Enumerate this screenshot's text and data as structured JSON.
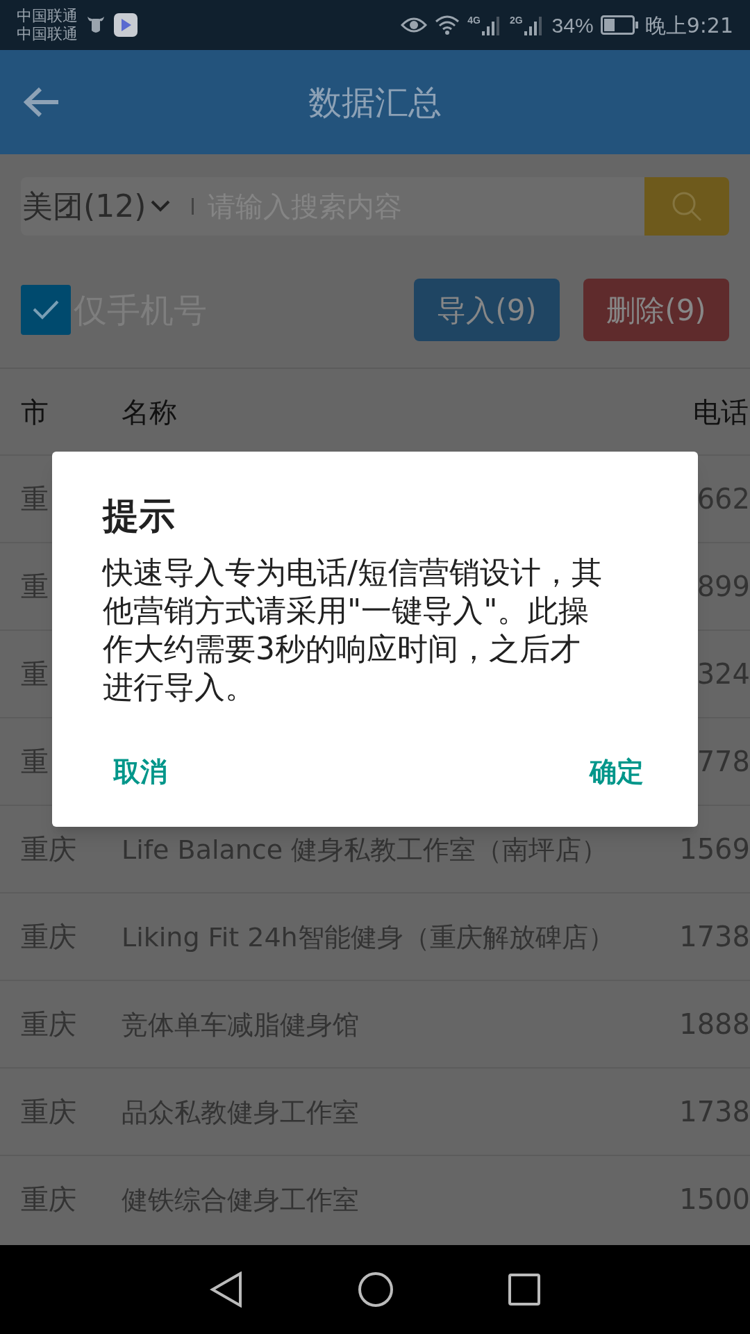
{
  "status_bar": {
    "carriers": [
      "中国联通",
      "中国联通"
    ],
    "network_labels": [
      "4G",
      "2G"
    ],
    "battery": "34%",
    "time": "晚上9:21"
  },
  "app_bar": {
    "title": "数据汇总"
  },
  "search": {
    "source": "美团(12)",
    "placeholder": "请输入搜索内容"
  },
  "filter": {
    "label": "仅手机号",
    "checked": true
  },
  "actions": [
    {
      "label": "导入(9)",
      "kind": "import"
    },
    {
      "label": "删除(9)",
      "kind": "delete"
    }
  ],
  "table": {
    "columns": [
      "市",
      "名称",
      "电话"
    ],
    "rows": [
      {
        "city": "重",
        "name": "",
        "phone": "662"
      },
      {
        "city": "重",
        "name": "",
        "phone": "899"
      },
      {
        "city": "重",
        "name": "",
        "phone": "324"
      },
      {
        "city": "重",
        "name": "",
        "phone": "778"
      },
      {
        "city": "重庆",
        "name": "Life Balance 健身私教工作室（南坪店）",
        "phone": "1569"
      },
      {
        "city": "重庆",
        "name": "Liking Fit 24h智能健身（重庆解放碑店）",
        "phone": "1738"
      },
      {
        "city": "重庆",
        "name": "竞体单车减脂健身馆",
        "phone": "1888"
      },
      {
        "city": "重庆",
        "name": "品众私教健身工作室",
        "phone": "1738"
      },
      {
        "city": "重庆",
        "name": "健铁综合健身工作室",
        "phone": "1500"
      }
    ]
  },
  "dialog": {
    "title": "提示",
    "message": "快速导入专为电话/短信营销设计，其他营销方式请采用\"一键导入\"。此操作大约需要3秒的响应时间，之后才进行导入。",
    "buttons": [
      {
        "label": "取消"
      },
      {
        "label": "确定"
      }
    ]
  }
}
